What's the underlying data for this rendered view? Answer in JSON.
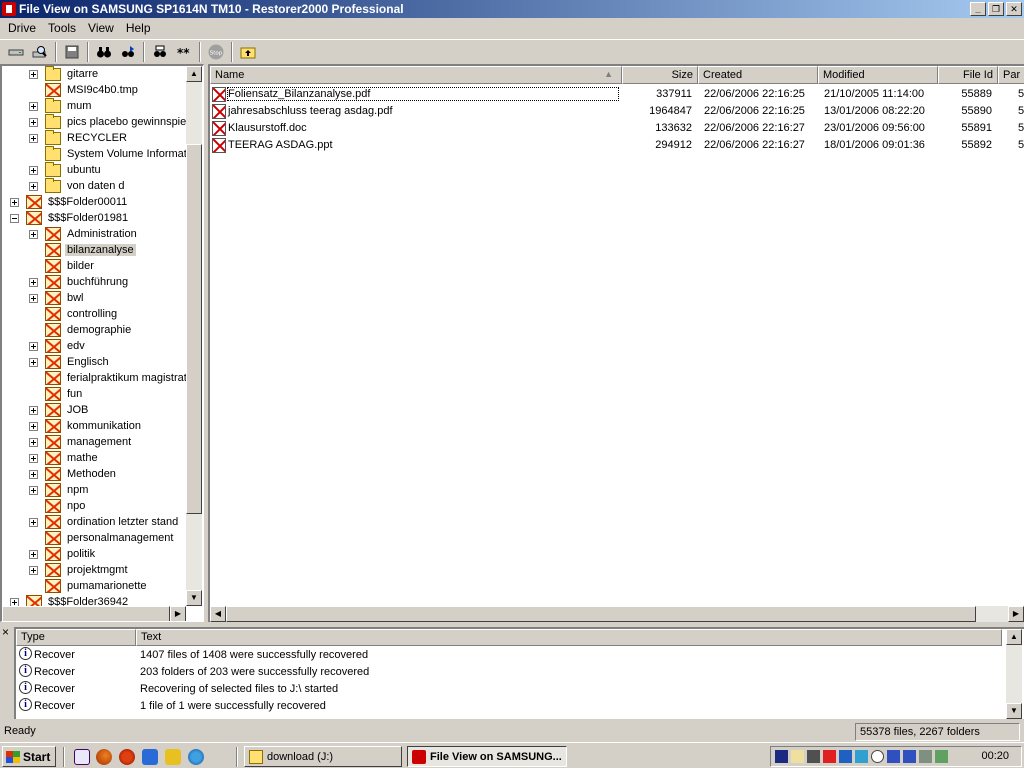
{
  "window": {
    "title": "File View  on SAMSUNG SP1614N TM10 - Restorer2000 Professional"
  },
  "menu": [
    "Drive",
    "Tools",
    "View",
    "Help"
  ],
  "toolbar": {
    "stop_label": "Stop"
  },
  "tree": {
    "items": [
      {
        "label": "gitarre",
        "icon": "folder",
        "level": 2,
        "expander": "plus"
      },
      {
        "label": "MSI9c4b0.tmp",
        "icon": "deleted-folder",
        "level": 2,
        "expander": "none"
      },
      {
        "label": "mum",
        "icon": "folder",
        "level": 2,
        "expander": "plus"
      },
      {
        "label": "pics placebo gewinnspiel",
        "icon": "folder",
        "level": 2,
        "expander": "plus"
      },
      {
        "label": "RECYCLER",
        "icon": "folder",
        "level": 2,
        "expander": "plus"
      },
      {
        "label": "System Volume Information",
        "icon": "folder",
        "level": 2,
        "expander": "none"
      },
      {
        "label": "ubuntu",
        "icon": "folder",
        "level": 2,
        "expander": "plus"
      },
      {
        "label": "von daten d",
        "icon": "folder",
        "level": 2,
        "expander": "plus"
      },
      {
        "label": "$$$Folder00011",
        "icon": "deleted-folder",
        "level": 1,
        "expander": "plus"
      },
      {
        "label": "$$$Folder01981",
        "icon": "deleted-folder",
        "level": 1,
        "expander": "minus"
      },
      {
        "label": "Administration",
        "icon": "deleted-folder",
        "level": 2,
        "expander": "plus"
      },
      {
        "label": "bilanzanalyse",
        "icon": "deleted-folder",
        "level": 2,
        "expander": "none",
        "selected": true
      },
      {
        "label": "bilder",
        "icon": "deleted-folder",
        "level": 2,
        "expander": "none"
      },
      {
        "label": "buchführung",
        "icon": "deleted-folder",
        "level": 2,
        "expander": "plus"
      },
      {
        "label": "bwl",
        "icon": "deleted-folder",
        "level": 2,
        "expander": "plus"
      },
      {
        "label": "controlling",
        "icon": "deleted-folder",
        "level": 2,
        "expander": "none"
      },
      {
        "label": "demographie",
        "icon": "deleted-folder",
        "level": 2,
        "expander": "none"
      },
      {
        "label": "edv",
        "icon": "deleted-folder",
        "level": 2,
        "expander": "plus"
      },
      {
        "label": "Englisch",
        "icon": "deleted-folder",
        "level": 2,
        "expander": "plus"
      },
      {
        "label": "ferialpraktikum magistrat",
        "icon": "deleted-folder",
        "level": 2,
        "expander": "none"
      },
      {
        "label": "fun",
        "icon": "deleted-folder",
        "level": 2,
        "expander": "none"
      },
      {
        "label": "JOB",
        "icon": "deleted-folder",
        "level": 2,
        "expander": "plus"
      },
      {
        "label": "kommunikation",
        "icon": "deleted-folder",
        "level": 2,
        "expander": "plus"
      },
      {
        "label": "management",
        "icon": "deleted-folder",
        "level": 2,
        "expander": "plus"
      },
      {
        "label": "mathe",
        "icon": "deleted-folder",
        "level": 2,
        "expander": "plus"
      },
      {
        "label": "Methoden",
        "icon": "deleted-folder",
        "level": 2,
        "expander": "plus"
      },
      {
        "label": "npm",
        "icon": "deleted-folder",
        "level": 2,
        "expander": "plus"
      },
      {
        "label": "npo",
        "icon": "deleted-folder",
        "level": 2,
        "expander": "none"
      },
      {
        "label": "ordination letzter stand",
        "icon": "deleted-folder",
        "level": 2,
        "expander": "plus"
      },
      {
        "label": "personalmanagement",
        "icon": "deleted-folder",
        "level": 2,
        "expander": "none"
      },
      {
        "label": "politik",
        "icon": "deleted-folder",
        "level": 2,
        "expander": "plus"
      },
      {
        "label": "projektmgmt",
        "icon": "deleted-folder",
        "level": 2,
        "expander": "plus"
      },
      {
        "label": "pumamarionette",
        "icon": "deleted-folder",
        "level": 2,
        "expander": "none"
      },
      {
        "label": "$$$Folder36942",
        "icon": "deleted-folder",
        "level": 1,
        "expander": "plus"
      }
    ]
  },
  "filelist": {
    "columns": [
      "Name",
      "Size",
      "Created",
      "Modified",
      "File Id",
      "Par"
    ],
    "rows": [
      {
        "name": "Foliensatz_Bilanzanalyse.pdf",
        "size": "337911",
        "created": "22/06/2006 22:16:25",
        "modified": "21/10/2005 11:14:00",
        "file_id": "55889",
        "par": "5",
        "focused": true
      },
      {
        "name": "jahresabschluss teerag asdag.pdf",
        "size": "1964847",
        "created": "22/06/2006 22:16:25",
        "modified": "13/01/2006 08:22:20",
        "file_id": "55890",
        "par": "5"
      },
      {
        "name": "Klausurstoff.doc",
        "size": "133632",
        "created": "22/06/2006 22:16:27",
        "modified": "23/01/2006 09:56:00",
        "file_id": "55891",
        "par": "5"
      },
      {
        "name": "TEERAG ASDAG.ppt",
        "size": "294912",
        "created": "22/06/2006 22:16:27",
        "modified": "18/01/2006 09:01:36",
        "file_id": "55892",
        "par": "5"
      }
    ]
  },
  "log": {
    "close_glyph": "×",
    "columns": [
      "Type",
      "Text"
    ],
    "rows": [
      {
        "type": "Recover",
        "text": "1407 files of 1408 were successfully recovered"
      },
      {
        "type": "Recover",
        "text": "203 folders of 203 were successfully recovered"
      },
      {
        "type": "Recover",
        "text": "Recovering of selected files to J:\\ started"
      },
      {
        "type": "Recover",
        "text": "1 file of 1 were successfully recovered"
      }
    ]
  },
  "status": {
    "left": "Ready",
    "right": "55378 files, 2267 folders"
  },
  "taskbar": {
    "start_label": "Start",
    "tasks": [
      {
        "label": "download (J:)",
        "active": false
      },
      {
        "label": "File View  on SAMSUNG...",
        "active": true
      }
    ],
    "clock": "00:20"
  },
  "colors": {
    "title_start": "#0a246a",
    "title_end": "#a6caf0",
    "face": "#d4d0c8",
    "deleted_mark": "#e03000"
  }
}
